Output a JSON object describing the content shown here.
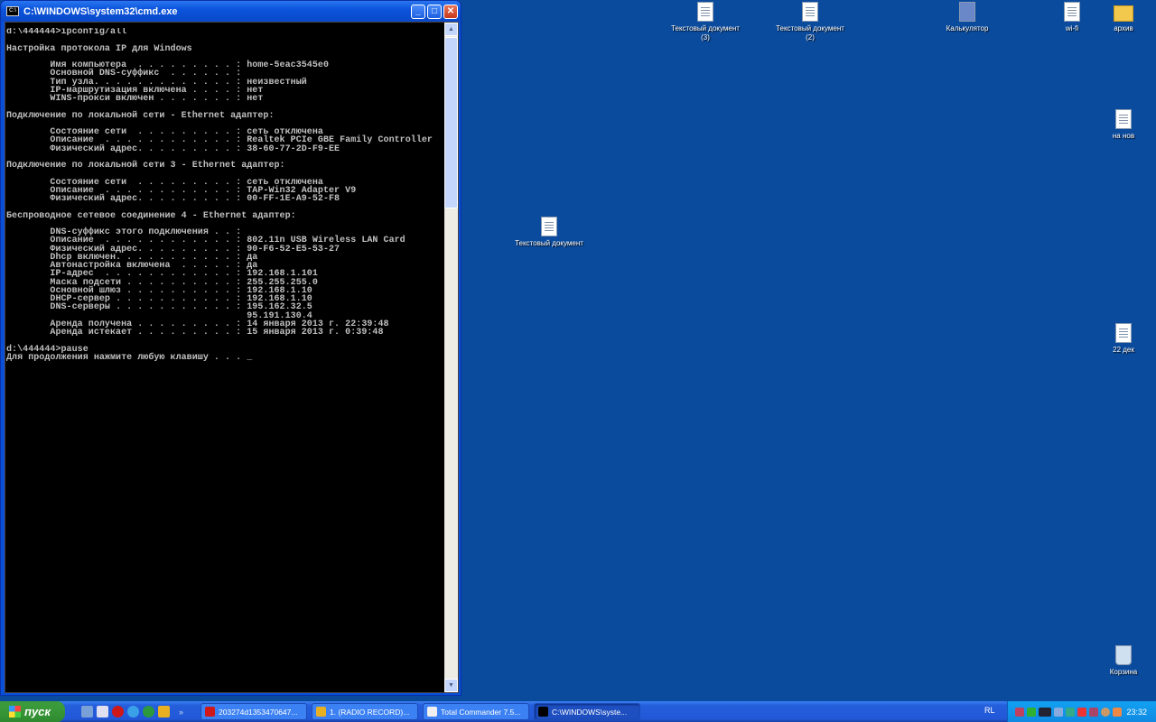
{
  "window": {
    "title": "C:\\WINDOWS\\system32\\cmd.exe",
    "minimize": "_",
    "maximize": "□",
    "close": "✕"
  },
  "console_lines": [
    "d:\\444444>ipconfig/all",
    "",
    "Настройка протокола IP для Windows",
    "",
    "        Имя компьютера  . . . . . . . . . : home-5eac3545e0",
    "        Основной DNS-суффикс  . . . . . . :",
    "        Тип узла. . . . . . . . . . . . . : неизвестный",
    "        IP-маршрутизация включена . . . . : нет",
    "        WINS-прокси включен . . . . . . . : нет",
    "",
    "Подключение по локальной сети - Ethernet адаптер:",
    "",
    "        Состояние сети  . . . . . . . . . : сеть отключена",
    "        Описание  . . . . . . . . . . . . : Realtek PCIe GBE Family Controller",
    "        Физический адрес. . . . . . . . . : 38-60-77-2D-F9-EE",
    "",
    "Подключение по локальной сети 3 - Ethernet адаптер:",
    "",
    "        Состояние сети  . . . . . . . . . : сеть отключена",
    "        Описание  . . . . . . . . . . . . : TAP-Win32 Adapter V9",
    "        Физический адрес. . . . . . . . . : 00-FF-1E-A9-52-F8",
    "",
    "Беспроводное сетевое соединение 4 - Ethernet адаптер:",
    "",
    "        DNS-суффикс этого подключения . . :",
    "        Описание  . . . . . . . . . . . . : 802.11n USB Wireless LAN Card",
    "        Физический адрес. . . . . . . . . : 90-F6-52-E5-53-27",
    "        Dhcp включен. . . . . . . . . . . : да",
    "        Автонастройка включена  . . . . . : да",
    "        IP-адрес  . . . . . . . . . . . . : 192.168.1.101",
    "        Маска подсети . . . . . . . . . . : 255.255.255.0",
    "        Основной шлюз . . . . . . . . . . : 192.168.1.10",
    "        DHCP-сервер . . . . . . . . . . . : 192.168.1.10",
    "        DNS-серверы . . . . . . . . . . . : 195.162.32.5",
    "                                            95.191.130.4",
    "        Аренда получена . . . . . . . . . : 14 января 2013 г. 22:39:48",
    "        Аренда истекает . . . . . . . . . : 15 января 2013 г. 0:39:48",
    "",
    "d:\\444444>pause",
    "Для продолжения нажмите любую клавишу . . . _"
  ],
  "desktop_icons": [
    {
      "label": "Текстовый документ (3)",
      "type": "doc"
    },
    {
      "label": "Текстовый документ (2)",
      "type": "doc"
    },
    {
      "label": "Калькулятор",
      "type": "calc"
    },
    {
      "label": "wi-fi",
      "type": "doc"
    },
    {
      "label": "архив",
      "type": "folder"
    },
    {
      "label": "на нов",
      "type": "doc"
    },
    {
      "label": "Текстовый документ",
      "type": "doc"
    },
    {
      "label": "22 дек",
      "type": "doc"
    },
    {
      "label": "Корзина",
      "type": "bin"
    }
  ],
  "taskbar": {
    "start": "пуск",
    "quicklaunch_more": "»",
    "tasks": [
      {
        "label": "203274d1353470647...",
        "color": "#d01818"
      },
      {
        "label": "1. (RADIO RECORD)...",
        "color": "#e8b020"
      },
      {
        "label": "Total Commander 7.5...",
        "color": "#f0f0f0"
      },
      {
        "label": "C:\\WINDOWS\\syste...",
        "color": "#000000"
      }
    ],
    "language": "RL",
    "clock": "23:32"
  }
}
